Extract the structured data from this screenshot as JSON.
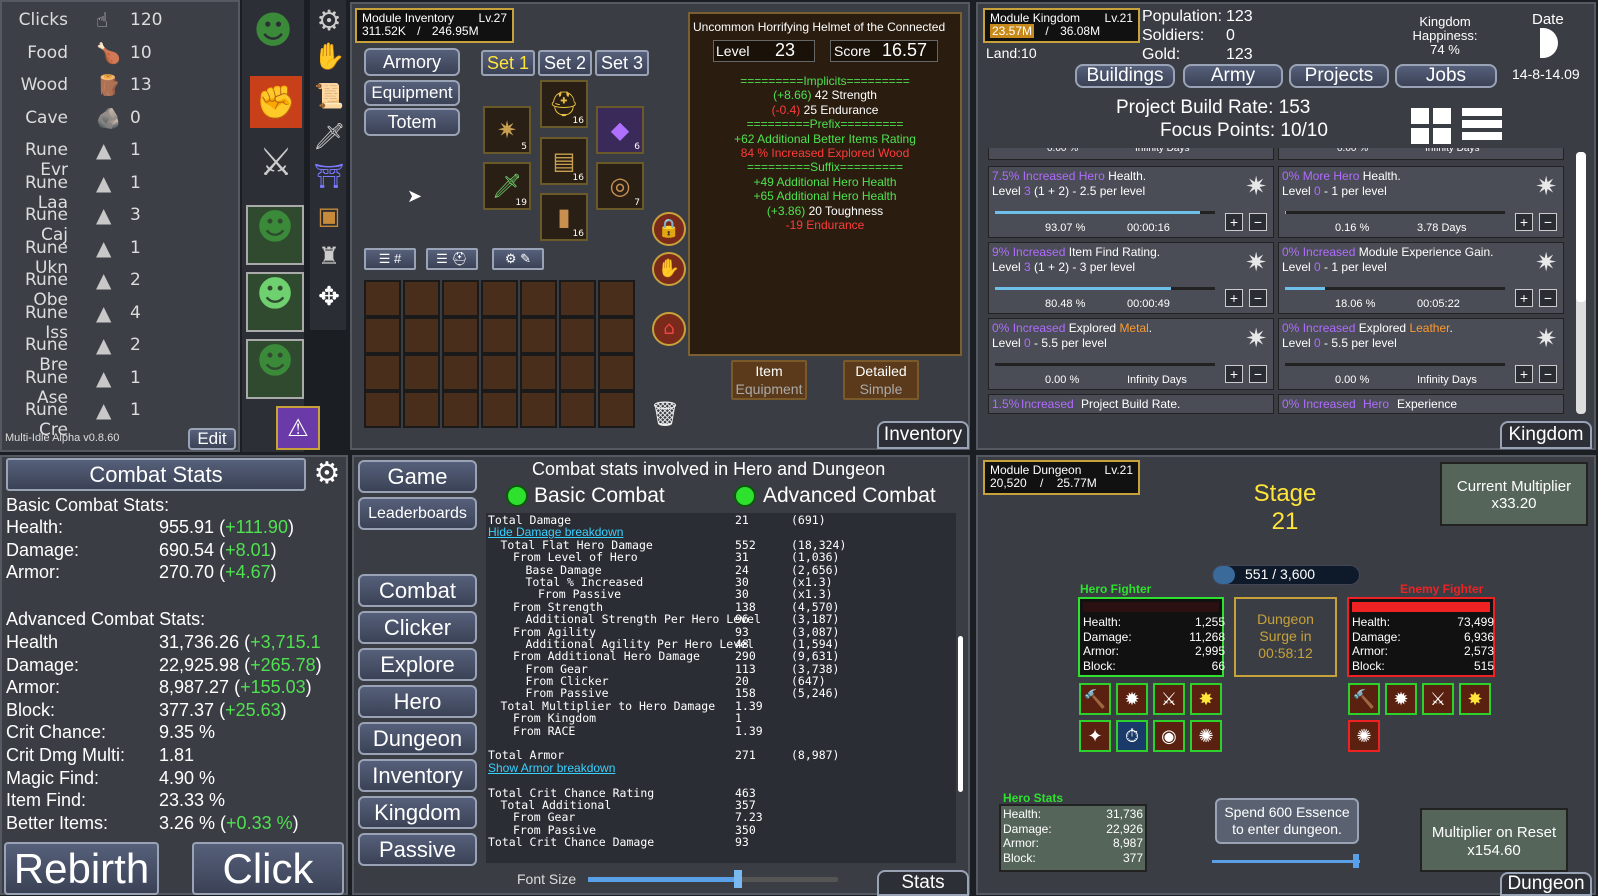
{
  "resources": [
    {
      "label": "Clicks",
      "icon": "hand-pointer-icon",
      "glyph": "☝",
      "value": "120"
    },
    {
      "label": "Food",
      "icon": "drumstick-icon",
      "glyph": "🍗",
      "value": "10"
    },
    {
      "label": "Wood",
      "icon": "log-icon",
      "glyph": "🪵",
      "value": "13"
    },
    {
      "label": "Cave",
      "icon": "rock-icon",
      "glyph": "🪨",
      "value": "0"
    },
    {
      "label": "Rune Evr",
      "icon": "rune-icon",
      "glyph": "▲",
      "value": "1"
    },
    {
      "label": "Rune Laa",
      "icon": "rune-icon",
      "glyph": "▲",
      "value": "1"
    },
    {
      "label": "Rune Caj",
      "icon": "rune-icon",
      "glyph": "▲",
      "value": "3"
    },
    {
      "label": "Rune Ukn",
      "icon": "rune-icon",
      "glyph": "▲",
      "value": "1"
    },
    {
      "label": "Rune Obe",
      "icon": "rune-icon",
      "glyph": "▲",
      "value": "2"
    },
    {
      "label": "Rune Iss",
      "icon": "rune-icon",
      "glyph": "▲",
      "value": "4"
    },
    {
      "label": "Rune Bre",
      "icon": "rune-icon",
      "glyph": "▲",
      "value": "2"
    },
    {
      "label": "Rune Ase",
      "icon": "rune-icon",
      "glyph": "▲",
      "value": "1"
    },
    {
      "label": "Rune Cre",
      "icon": "rune-icon",
      "glyph": "▲",
      "value": "1"
    }
  ],
  "version": "Multi-Idle Alpha v0.8.60",
  "edit_label": "Edit",
  "inventory": {
    "module": "Module Inventory",
    "level": "Lv.27",
    "xp_cur": "311.52K",
    "xp_sep": "/",
    "xp_max": "246.95M",
    "buttons": {
      "armory": "Armory",
      "equipment": "Equipment",
      "totem": "Totem"
    },
    "sets": [
      "Set 1",
      "Set 2",
      "Set 3"
    ],
    "slot_counts": [
      "5",
      "16",
      "6",
      "19",
      "16",
      "7",
      "16"
    ],
    "tooltip": {
      "title": "Uncommon Horrifying Helmet of the Connected",
      "level_label": "Level",
      "level": "23",
      "score_label": "Score",
      "score": "16.57",
      "implicits_header": "=========Implicits=========",
      "implicit1_val": "(+8.66)",
      "implicit1_text": "42 Strength",
      "implicit2_val": "(-0.4)",
      "implicit2_text": "25 Endurance",
      "prefix_header": "=========Prefix=========",
      "prefix1": "+62 Additional Better Items Rating",
      "prefix2": "84 % Increased Explored Wood",
      "suffix_header": "=========Suffix=========",
      "suffix1": "+49 Additional Hero Health",
      "suffix2": "+65 Additional Hero Health",
      "suffix3_val": "(+3.86)",
      "suffix3_text": "20 Toughness",
      "suffix4": "-19 Endurance"
    },
    "item_btn": "Item",
    "equipment_btn": "Equipment",
    "detailed_btn": "Detailed",
    "simple_btn": "Simple",
    "tab_label": "Inventory"
  },
  "kingdom": {
    "module": "Module Kingdom",
    "level": "Lv.21",
    "xp_cur": "23.57M",
    "xp_sep": "/",
    "xp_max": "36.08M",
    "land": "Land:10",
    "population_label": "Population:",
    "population": "123",
    "soldiers_label": "Soldiers:",
    "soldiers": "0",
    "gold_label": "Gold:",
    "gold": "123",
    "happiness_label": "Kingdom",
    "happiness_label2": "Happiness:",
    "happiness": "74 %",
    "date_label": "Date",
    "date": "14-8-14.09",
    "tabs": [
      "Buildings",
      "Army",
      "Projects",
      "Jobs"
    ],
    "build_rate": "Project Build Rate: 153",
    "focus": "Focus Points: 10/10",
    "top_row_left": {
      "pct": "0.00 %",
      "time": "Infinity Days"
    },
    "top_row_right": {
      "pct": "0.00 %",
      "time": "Infinity Days"
    },
    "projects": [
      {
        "pre": "7.5%",
        "kw": "Increased",
        "hl": "Hero",
        "post": "Health.",
        "lvl": "Level ",
        "lvlnum": "3",
        "lvlrest": " (1 + 2) - 2.5 per level",
        "pct": "93.07 %",
        "time": "00:00:16",
        "progress": 0.93
      },
      {
        "pre": "0%",
        "kw": "More",
        "hl": "Hero",
        "post": "Health.",
        "lvl": "Level ",
        "lvlnum": "0",
        "lvlrest": " - 1 per level",
        "pct": "0.16 %",
        "time": "3.78 Days",
        "progress": 0.0016
      },
      {
        "pre": "9%",
        "kw": "Increased",
        "hl": "",
        "post": "Item Find Rating.",
        "lvl": "Level ",
        "lvlnum": "3",
        "lvlrest": " (1 + 2) - 3 per level",
        "pct": "80.48 %",
        "time": "00:00:49",
        "progress": 0.8
      },
      {
        "pre": "0%",
        "kw": "Increased",
        "hl": "",
        "post": "Module Experience Gain.",
        "lvl": "Level ",
        "lvlnum": "0",
        "lvlrest": " - 1 per level",
        "pct": "18.06 %",
        "time": "00:05:22",
        "progress": 0.18
      },
      {
        "pre": "0%",
        "kw": "Increased",
        "hl": "",
        "post": "Explored ",
        "hl2": "Metal",
        "post2": ".",
        "lvl": "Level ",
        "lvlnum": "0",
        "lvlrest": " - 5.5 per level",
        "pct": "0.00 %",
        "time": "Infinity Days",
        "progress": 0
      },
      {
        "pre": "0%",
        "kw": "Increased",
        "hl": "",
        "post": "Explored ",
        "hl2": "Leather",
        "post2": ".",
        "lvl": "Level ",
        "lvlnum": "0",
        "lvlrest": " - 5.5 per level",
        "pct": "0.00 %",
        "time": "Infinity Days",
        "progress": 0
      }
    ],
    "bottom_left": {
      "pre": "1.5%",
      "kw": "Increased",
      "post": "Project Build Rate."
    },
    "bottom_right": {
      "pre": "0%",
      "kw": "Increased",
      "hl": "Hero",
      "post": "Experience"
    },
    "tab_label": "Kingdom"
  },
  "combat": {
    "header": "Combat Stats",
    "basic_title": "Basic Combat Stats:",
    "basic": [
      {
        "label": "Health:",
        "value": "955.91",
        "delta": "+111.90"
      },
      {
        "label": "Damage:",
        "value": "690.54",
        "delta": "+8.01"
      },
      {
        "label": "Armor:",
        "value": "270.70",
        "delta": "+4.67"
      }
    ],
    "advanced_title": "Advanced Combat Stats:",
    "advanced": [
      {
        "label": "Health",
        "value": "31,736.26",
        "delta": "+3,715.1"
      },
      {
        "label": "Damage:",
        "value": "22,925.98",
        "delta": "+265.78"
      },
      {
        "label": "Armor:",
        "value": "8,987.27",
        "delta": "+155.03"
      },
      {
        "label": "Block:",
        "value": "377.37",
        "delta": "+25.63"
      },
      {
        "label": "Crit Chance:",
        "value": "9.35 %",
        "delta": ""
      },
      {
        "label": "Crit Dmg Multi:",
        "value": "1.81",
        "delta": ""
      },
      {
        "label": "Magic Find:",
        "value": "4.90 %",
        "delta": ""
      },
      {
        "label": "Item Find:",
        "value": "23.33 %",
        "delta": ""
      },
      {
        "label": "Better Items:",
        "value": "3.26 %",
        "delta": "+0.33 %"
      }
    ],
    "rebirth": "Rebirth",
    "click": "Click"
  },
  "nav": [
    "Game",
    "Leaderboards",
    "Combat",
    "Clicker",
    "Explore",
    "Hero",
    "Dungeon",
    "Inventory",
    "Kingdom",
    "Passive"
  ],
  "stats": {
    "title": "Combat stats involved in Hero and Dungeon",
    "basic_toggle": "Basic Combat",
    "advanced_toggle": "Advanced Combat",
    "hide_link": "Hide Damage breakdown",
    "show_armor_link": "Show Armor breakdown",
    "rows": [
      {
        "indent": 0,
        "label": "Total Damage",
        "v": "21",
        "t": "(691)"
      },
      {
        "indent": 0,
        "link": "hide"
      },
      {
        "indent": 1,
        "label": "Total Flat Hero Damage",
        "v": "552",
        "t": "(18,324)"
      },
      {
        "indent": 2,
        "label": "From Level of Hero",
        "v": "31",
        "t": "(1,036)"
      },
      {
        "indent": 3,
        "label": "Base Damage",
        "v": "24",
        "t": "(2,656)"
      },
      {
        "indent": 3,
        "label": "Total % Increased",
        "v": "30",
        "t": "(x1.3)"
      },
      {
        "indent": 4,
        "label": "From Passive",
        "v": "30",
        "t": "(x1.3)"
      },
      {
        "indent": 2,
        "label": "From Strength",
        "v": "138",
        "t": "(4,570)"
      },
      {
        "indent": 3,
        "label": "Additional Strength Per Hero Level",
        "v": "96",
        "t": "(3,187)"
      },
      {
        "indent": 2,
        "label": "From Agility",
        "v": "93",
        "t": "(3,087)"
      },
      {
        "indent": 3,
        "label": "Additional Agility Per Hero Level",
        "v": "48",
        "t": "(1,594)"
      },
      {
        "indent": 2,
        "label": "From Additional Hero Damage",
        "v": "290",
        "t": "(9,631)"
      },
      {
        "indent": 3,
        "label": "From Gear",
        "v": "113",
        "t": "(3,738)"
      },
      {
        "indent": 3,
        "label": "From Clicker",
        "v": "20",
        "t": "(647)"
      },
      {
        "indent": 3,
        "label": "From Passive",
        "v": "158",
        "t": "(5,246)"
      },
      {
        "indent": 1,
        "label": "Total Multiplier to Hero Damage",
        "v": "1.39",
        "t": ""
      },
      {
        "indent": 2,
        "label": "From Kingdom",
        "v": "1",
        "t": ""
      },
      {
        "indent": 2,
        "label": "From RACE",
        "v": "1.39",
        "t": ""
      },
      {
        "indent": 0,
        "label": "",
        "v": "",
        "t": ""
      },
      {
        "indent": 0,
        "label": "Total Armor",
        "v": "271",
        "t": "(8,987)"
      },
      {
        "indent": 0,
        "link": "armor"
      },
      {
        "indent": 0,
        "label": "",
        "v": "",
        "t": ""
      },
      {
        "indent": 0,
        "label": "Total Crit Chance Rating",
        "v": "463",
        "t": ""
      },
      {
        "indent": 1,
        "label": "Total Additional",
        "v": "357",
        "t": ""
      },
      {
        "indent": 2,
        "label": "From Gear",
        "v": "7.23",
        "t": ""
      },
      {
        "indent": 2,
        "label": "From Passive",
        "v": "350",
        "t": ""
      },
      {
        "indent": 0,
        "label": "Total Crit Chance Damage",
        "v": "93",
        "t": ""
      }
    ],
    "font_size_label": "Font Size",
    "font_size_level": 0.6,
    "tab_label": "Stats"
  },
  "dungeon": {
    "module": "Module Dungeon",
    "level": "Lv.21",
    "xp_cur": "20,520",
    "xp_sep": "/",
    "xp_max": "25.77M",
    "stage_label": "Stage",
    "stage": "21",
    "current_multiplier_label": "Current Multiplier",
    "current_multiplier": "x33.20",
    "progress": "551 / 3,600",
    "progress_value": 0.153,
    "hero_title": "Hero Fighter",
    "enemy_title": "Enemy Fighter",
    "hero": [
      {
        "k": "Health:",
        "v": "1,255"
      },
      {
        "k": "Damage:",
        "v": "11,268"
      },
      {
        "k": "Armor:",
        "v": "2,995"
      },
      {
        "k": "Block:",
        "v": "66"
      }
    ],
    "enemy": [
      {
        "k": "Health:",
        "v": "73,499"
      },
      {
        "k": "Damage:",
        "v": "6,936"
      },
      {
        "k": "Armor:",
        "v": "2,573"
      },
      {
        "k": "Block:",
        "v": "515"
      }
    ],
    "surge1": "Dungeon",
    "surge2": "Surge in",
    "surge3": "00:58:12",
    "hero_stats_title": "Hero Stats",
    "hero_stats": [
      {
        "k": "Health:",
        "v": "31,736"
      },
      {
        "k": "Damage:",
        "v": "22,926"
      },
      {
        "k": "Armor:",
        "v": "8,987"
      },
      {
        "k": "Block:",
        "v": "377"
      }
    ],
    "spend1": "Spend 600 Essence",
    "spend2": "to enter dungeon.",
    "reset_label": "Multiplier on Reset",
    "reset_value": "x154.60",
    "tab_label": "Dungeon"
  },
  "colors": {
    "accent": "#4fe14f",
    "negative": "#ff3b3b",
    "gold_border": "#c7a13a"
  }
}
